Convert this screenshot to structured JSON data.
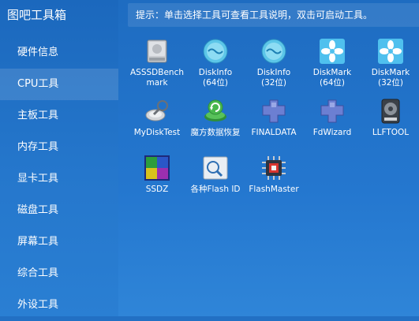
{
  "app": {
    "title": "图吧工具箱"
  },
  "sidebar": {
    "items": [
      {
        "label": "硬件信息"
      },
      {
        "label": "CPU工具"
      },
      {
        "label": "主板工具"
      },
      {
        "label": "内存工具"
      },
      {
        "label": "显卡工具"
      },
      {
        "label": "磁盘工具"
      },
      {
        "label": "屏幕工具"
      },
      {
        "label": "综合工具"
      },
      {
        "label": "外设工具"
      }
    ],
    "active_index": 1
  },
  "hint": "提示：单击选择工具可查看工具说明，双击可启动工具。",
  "tools": [
    {
      "line1": "ASSSDBench",
      "line2": "mark",
      "icon": "hdd-gray-icon"
    },
    {
      "line1": "DiskInfo",
      "line2": "(64位)",
      "icon": "diskinfo-icon"
    },
    {
      "line1": "DiskInfo",
      "line2": "(32位)",
      "icon": "diskinfo-icon"
    },
    {
      "line1": "DiskMark",
      "line2": "(64位)",
      "icon": "flower-icon"
    },
    {
      "line1": "DiskMark",
      "line2": "(32位)",
      "icon": "flower-icon"
    },
    {
      "line1": "MyDiskTest",
      "line2": "",
      "icon": "disk-test-icon"
    },
    {
      "line1": "魔方数据恢复",
      "line2": "",
      "icon": "recovery-icon"
    },
    {
      "line1": "FINALDATA",
      "line2": "",
      "icon": "puzzle-icon"
    },
    {
      "line1": "FdWizard",
      "line2": "",
      "icon": "puzzle-icon"
    },
    {
      "line1": "LLFTOOL",
      "line2": "",
      "icon": "hdd-dark-icon"
    },
    {
      "line1": "SSDZ",
      "line2": "",
      "icon": "ssdz-icon"
    },
    {
      "line1": "各种Flash ID",
      "line2": "",
      "icon": "flash-id-icon"
    },
    {
      "line1": "FlashMaster",
      "line2": "",
      "icon": "chip-icon"
    }
  ]
}
